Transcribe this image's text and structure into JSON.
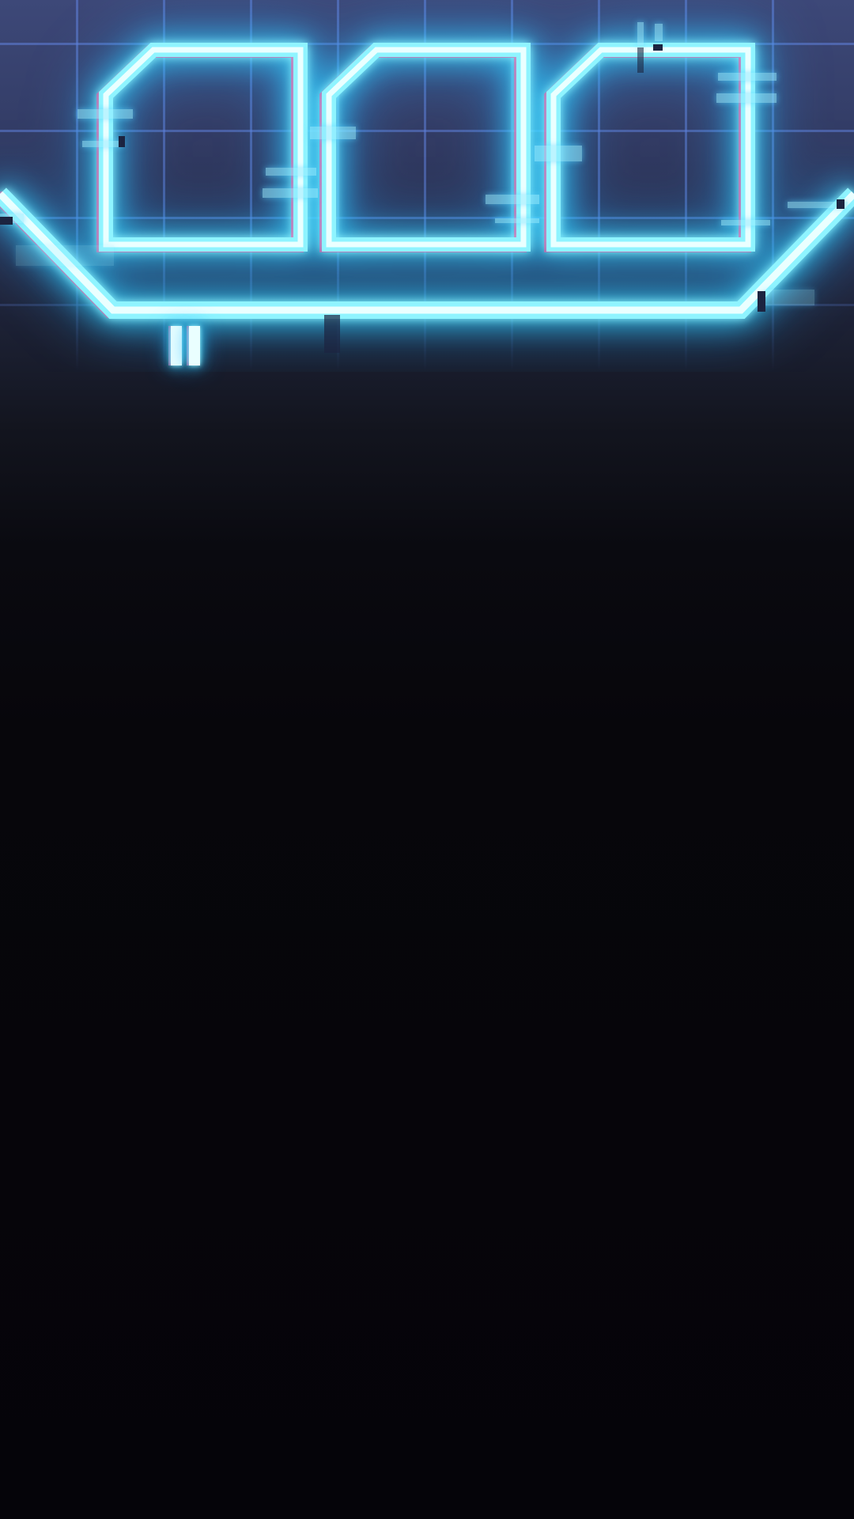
{
  "hud": {
    "score_digits": [
      "0",
      "0",
      "0"
    ],
    "colors": {
      "neon": "#8ff4ff",
      "neon_core": "#eaffff",
      "glow": "#36d6ff",
      "chromatic_magenta": "#ff50a0",
      "grid": "#6e96ff",
      "background_top": "#3d4878",
      "background_bottom": "#050409"
    }
  },
  "controls": {
    "pause_icon": "pause-icon"
  }
}
